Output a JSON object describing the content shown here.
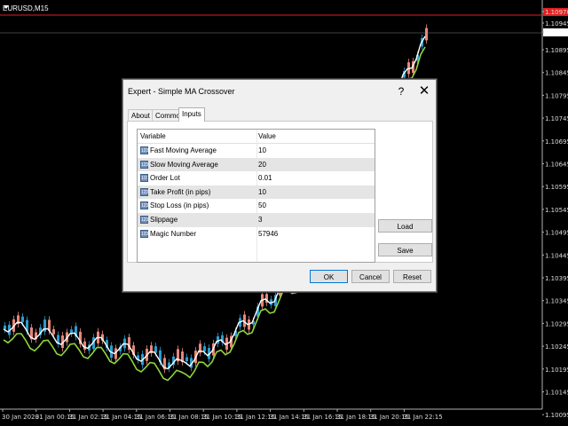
{
  "chart": {
    "symbol": "EURUSD,M15",
    "colors": {
      "bull": "#2a9ccf",
      "bear": "#e8877a",
      "fast_ma": "#ffffff",
      "slow_ma": "#8fd63a",
      "bid_line": "#e02020",
      "grid_line": "#808080"
    },
    "price_labels": [
      {
        "text": "1.10970",
        "highlight": true
      },
      {
        "text": "1.10945"
      },
      {
        "text": "1.10933",
        "boxed": true
      },
      {
        "text": "1.10895"
      },
      {
        "text": "1.10845"
      },
      {
        "text": "1.10795"
      },
      {
        "text": "1.10745"
      },
      {
        "text": "1.10695"
      },
      {
        "text": "1.10645"
      },
      {
        "text": "1.10595"
      },
      {
        "text": "1.10545"
      },
      {
        "text": "1.10495"
      },
      {
        "text": "1.10445"
      },
      {
        "text": "1.10395"
      },
      {
        "text": "1.10345"
      },
      {
        "text": "1.10295"
      },
      {
        "text": "1.10245"
      },
      {
        "text": "1.10195"
      },
      {
        "text": "1.10145"
      },
      {
        "text": "1.10095"
      }
    ],
    "time_labels": [
      "30 Jan 2020",
      "31 Jan 00:15",
      "31 Jan 02:15",
      "31 Jan 04:15",
      "31 Jan 06:15",
      "31 Jan 08:15",
      "31 Jan 10:15",
      "31 Jan 12:15",
      "31 Jan 14:15",
      "31 Jan 16:15",
      "31 Jan 18:15",
      "31 Jan 20:15",
      "31 Jan 22:15"
    ]
  },
  "dialog": {
    "title": "Expert - Simple MA Crossover",
    "help": "?",
    "close": "✕",
    "tabs": [
      "About",
      "Common",
      "Inputs"
    ],
    "active_tab": "Inputs",
    "grid": {
      "headers": {
        "variable": "Variable",
        "value": "Value"
      },
      "rows": [
        {
          "icon": "123",
          "variable": "Fast Moving Average",
          "value": "10"
        },
        {
          "icon": "123",
          "variable": "Slow Moving Average",
          "value": "20"
        },
        {
          "icon": "1/2",
          "variable": "Order Lot",
          "value": "0.01"
        },
        {
          "icon": "123",
          "variable": "Take Profit (in pips)",
          "value": "10"
        },
        {
          "icon": "123",
          "variable": "Stop Loss (in pips)",
          "value": "50"
        },
        {
          "icon": "123",
          "variable": "Slippage",
          "value": "3"
        },
        {
          "icon": "123",
          "variable": "Magic Number",
          "value": "57946"
        }
      ]
    },
    "buttons": {
      "load": "Load",
      "save": "Save",
      "ok": "OK",
      "cancel": "Cancel",
      "reset": "Reset"
    }
  }
}
